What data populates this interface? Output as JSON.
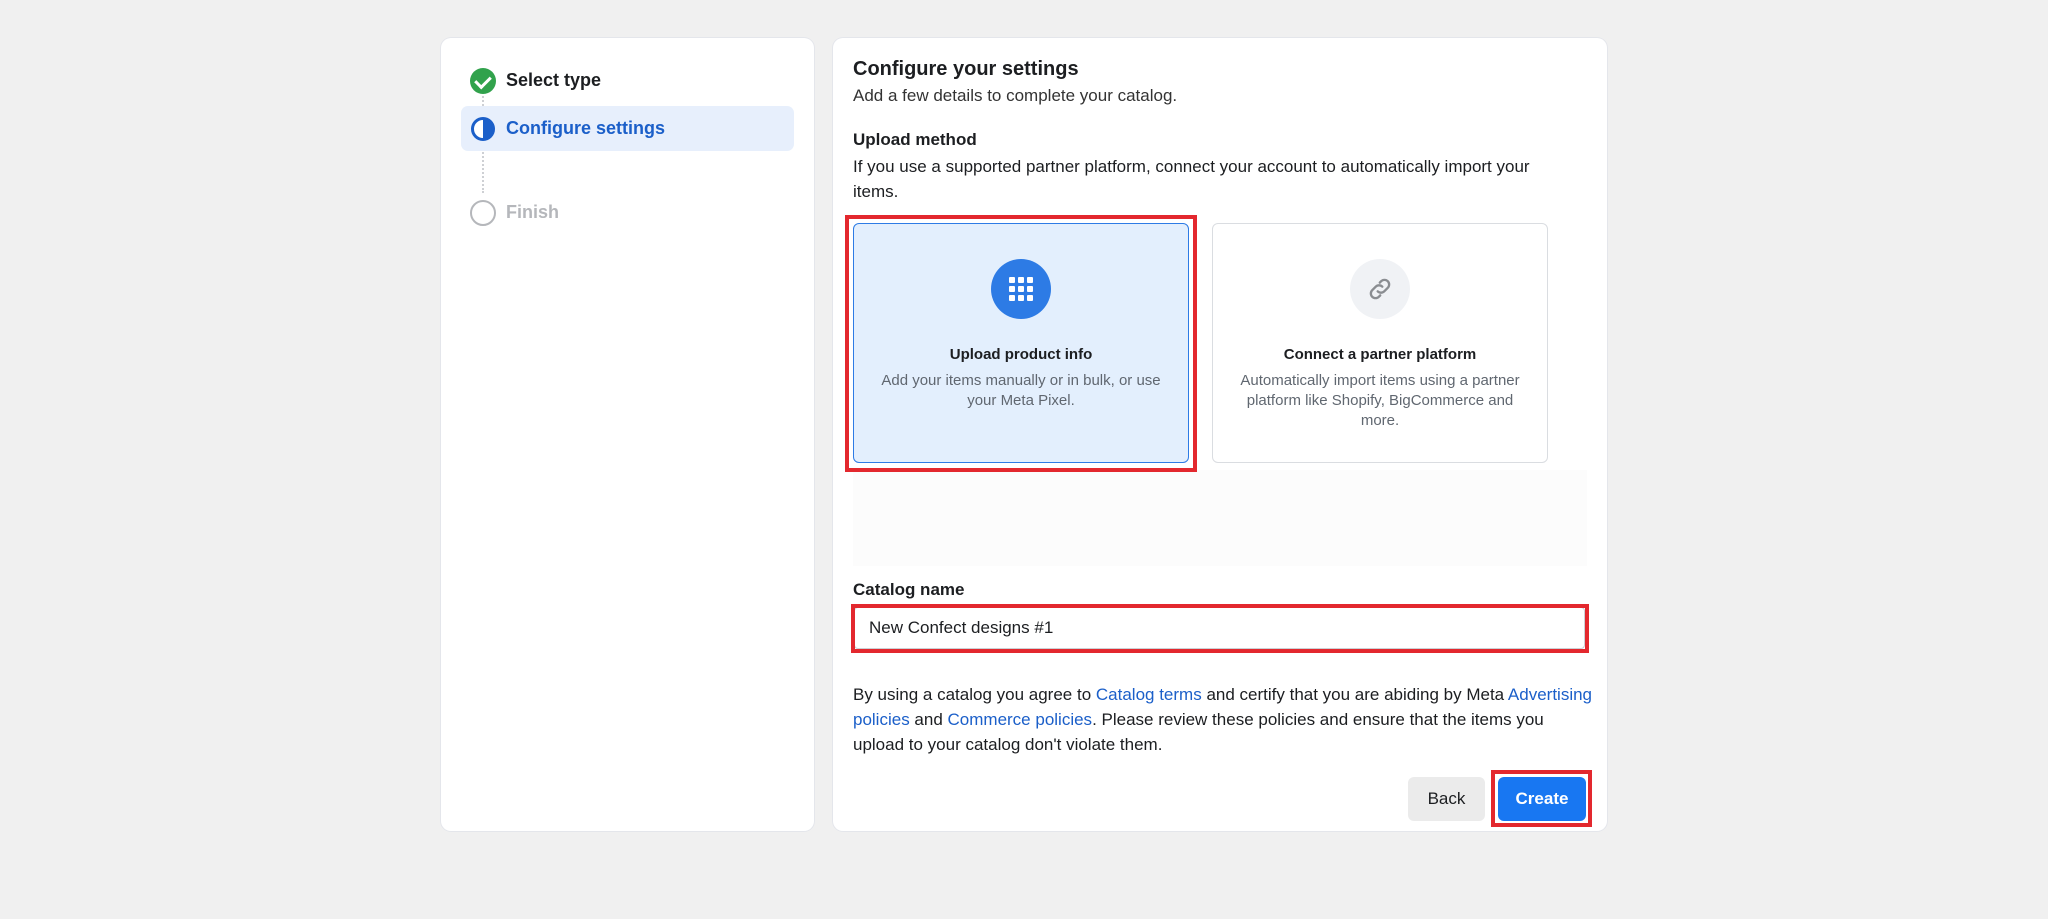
{
  "stepper": {
    "steps": [
      {
        "label": "Select type",
        "state": "done"
      },
      {
        "label": "Configure settings",
        "state": "active"
      },
      {
        "label": "Finish",
        "state": "pending"
      }
    ]
  },
  "main": {
    "title": "Configure your settings",
    "subtitle": "Add a few details to complete your catalog.",
    "upload_method": {
      "heading": "Upload method",
      "description": "If you use a supported partner platform, connect your account to automatically import your items.",
      "options": [
        {
          "title": "Upload product info",
          "text": "Add your items manually or in bulk, or use your Meta Pixel.",
          "icon": "grid-icon",
          "selected": true
        },
        {
          "title": "Connect a partner platform",
          "text": "Automatically import items using a partner platform like Shopify, BigCommerce and more.",
          "icon": "link-icon",
          "selected": false
        }
      ]
    },
    "catalog_name": {
      "label": "Catalog name",
      "value": "New Confect designs #1"
    },
    "terms": {
      "t1": "By using a catalog you agree to ",
      "link1": "Catalog terms",
      "t2": " and certify that you are abiding by Meta ",
      "link2": "Advertising policies",
      "t3": " and ",
      "link3": "Commerce policies",
      "t4": ". Please review these policies and ensure that the items you upload to your catalog don't violate them."
    },
    "buttons": {
      "back": "Back",
      "create": "Create"
    }
  },
  "colors": {
    "accent": "#1877f2",
    "active_step": "#1b5fc9",
    "done_step": "#31a24c",
    "highlight": "#e3282e"
  }
}
